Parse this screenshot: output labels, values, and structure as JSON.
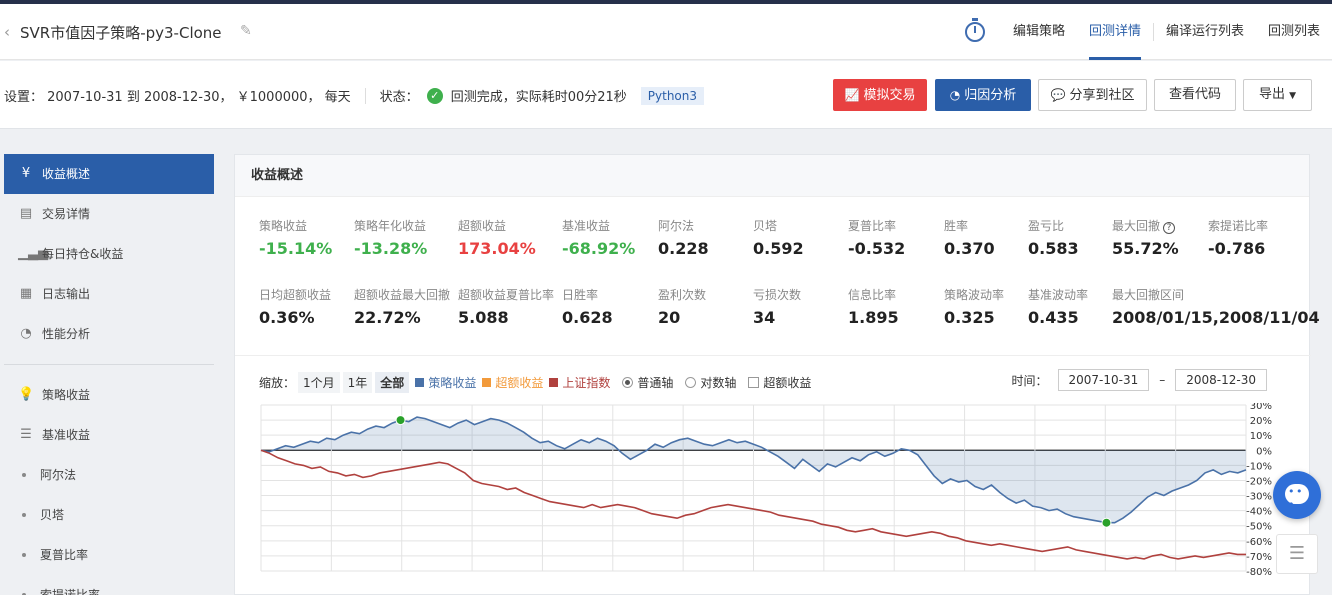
{
  "header": {
    "back_icon": "chevron-left",
    "title": "SVR市值因子策略-py3-Clone",
    "nav": [
      "编辑策略",
      "回测详情",
      "编译运行列表",
      "回测列表"
    ],
    "active_nav": "回测详情"
  },
  "info": {
    "settings": "设置： 2007-10-31 到 2008-12-30， ￥1000000， 每天",
    "status_label": "状态：",
    "status_text": "回测完成，实际耗时00分21秒",
    "language": "Python3"
  },
  "buttons": {
    "simulate": "模拟交易",
    "attribution": "归因分析",
    "share": "分享到社区",
    "view_code": "查看代码",
    "export": "导出"
  },
  "sidebar": {
    "items": [
      {
        "label": "收益概述",
        "icon": "yen-icon",
        "active": true
      },
      {
        "label": "交易详情",
        "icon": "doc-icon"
      },
      {
        "label": "每日持仓&收益",
        "icon": "chart-icon"
      },
      {
        "label": "日志输出",
        "icon": "log-icon"
      },
      {
        "label": "性能分析",
        "icon": "pie-icon"
      }
    ],
    "sub_items": [
      {
        "label": "策略收益",
        "icon": "bulb-icon"
      },
      {
        "label": "基准收益",
        "icon": "db-icon"
      },
      {
        "label": "阿尔法",
        "icon": "dot"
      },
      {
        "label": "贝塔",
        "icon": "dot"
      },
      {
        "label": "夏普比率",
        "icon": "dot"
      },
      {
        "label": "索提诺比率",
        "icon": "dot"
      }
    ]
  },
  "panel": {
    "title": "收益概述",
    "metrics_row1": [
      {
        "label": "策略收益",
        "value": "-15.14%",
        "color": "green"
      },
      {
        "label": "策略年化收益",
        "value": "-13.28%",
        "color": "green"
      },
      {
        "label": "超额收益",
        "value": "173.04%",
        "color": "red"
      },
      {
        "label": "基准收益",
        "value": "-68.92%",
        "color": "green"
      },
      {
        "label": "阿尔法",
        "value": "0.228",
        "color": ""
      },
      {
        "label": "贝塔",
        "value": "0.592",
        "color": ""
      },
      {
        "label": "夏普比率",
        "value": "-0.532",
        "color": ""
      },
      {
        "label": "胜率",
        "value": "0.370",
        "color": ""
      },
      {
        "label": "盈亏比",
        "value": "0.583",
        "color": ""
      },
      {
        "label": "最大回撤",
        "value": "55.72%",
        "color": ""
      },
      {
        "label": "索提诺比率",
        "value": "-0.786",
        "color": ""
      }
    ],
    "metrics_row2": [
      {
        "label": "日均超额收益",
        "value": "0.36%"
      },
      {
        "label": "超额收益最大回撤",
        "value": "22.72%"
      },
      {
        "label": "超额收益夏普比率",
        "value": "5.088"
      },
      {
        "label": "日胜率",
        "value": "0.628"
      },
      {
        "label": "盈利次数",
        "value": "20"
      },
      {
        "label": "亏损次数",
        "value": "34"
      },
      {
        "label": "信息比率",
        "value": "1.895"
      },
      {
        "label": "策略波动率",
        "value": "0.325"
      },
      {
        "label": "基准波动率",
        "value": "0.435"
      },
      {
        "label": "最大回撤区间",
        "value": "2008/01/15,2008/11/04"
      }
    ]
  },
  "chart_controls": {
    "zoom_label": "缩放：",
    "zoom_options": [
      "1个月",
      "1年",
      "全部"
    ],
    "active_zoom": "全部",
    "legend": [
      {
        "name": "策略收益",
        "color": "#4a72a8"
      },
      {
        "name": "超额收益",
        "color": "#f29a3b"
      },
      {
        "name": "上证指数",
        "color": "#b0413e"
      }
    ],
    "axis_options": [
      "普通轴",
      "对数轴"
    ],
    "active_axis": "普通轴",
    "excess_checkbox": "超额收益",
    "time_label": "时间：",
    "start_date": "2007-10-31",
    "end_date": "2008-12-30",
    "range_sep": "–"
  },
  "chart_data": {
    "type": "line",
    "y_ticks": [
      "30%",
      "20%",
      "10%",
      "0%",
      "-10%",
      "-20%",
      "-30%",
      "-40%",
      "-50%",
      "-60%",
      "-70%",
      "-80%"
    ],
    "ylim": [
      -80,
      30
    ],
    "series": [
      {
        "name": "策略收益",
        "color": "#4a72a8",
        "values": [
          0,
          -1,
          1,
          3,
          2,
          4,
          6,
          5,
          8,
          7,
          10,
          12,
          11,
          14,
          16,
          15,
          18,
          20,
          19,
          22,
          21,
          19,
          17,
          15,
          18,
          20,
          17,
          19,
          21,
          20,
          18,
          15,
          12,
          8,
          5,
          6,
          3,
          1,
          4,
          7,
          5,
          8,
          6,
          3,
          -2,
          -6,
          -3,
          0,
          4,
          2,
          5,
          7,
          8,
          6,
          4,
          3,
          5,
          7,
          5,
          6,
          4,
          2,
          -1,
          -4,
          -8,
          -12,
          -6,
          -10,
          -14,
          -9,
          -11,
          -8,
          -5,
          -7,
          -3,
          -1,
          -4,
          -2,
          1,
          0,
          -3,
          -10,
          -17,
          -22,
          -19,
          -21,
          -20,
          -24,
          -26,
          -23,
          -28,
          -32,
          -35,
          -33,
          -37,
          -38,
          -40,
          -39,
          -42,
          -44,
          -45,
          -46,
          -47,
          -48,
          -48,
          -45,
          -41,
          -36,
          -31,
          -28,
          -30,
          -27,
          -25,
          -23,
          -20,
          -15,
          -13,
          -16,
          -14,
          -15,
          -13
        ]
      },
      {
        "name": "上证指数",
        "color": "#b0413e",
        "values": [
          0,
          -2,
          -5,
          -7,
          -9,
          -10,
          -12,
          -11,
          -14,
          -15,
          -17,
          -16,
          -18,
          -17,
          -15,
          -14,
          -13,
          -12,
          -11,
          -10,
          -9,
          -8,
          -9,
          -12,
          -15,
          -20,
          -22,
          -23,
          -24,
          -26,
          -25,
          -28,
          -30,
          -32,
          -34,
          -35,
          -36,
          -37,
          -38,
          -36,
          -38,
          -37,
          -36,
          -37,
          -38,
          -40,
          -42,
          -43,
          -44,
          -45,
          -43,
          -42,
          -40,
          -38,
          -37,
          -36,
          -37,
          -38,
          -39,
          -40,
          -41,
          -43,
          -44,
          -45,
          -46,
          -47,
          -49,
          -50,
          -51,
          -53,
          -54,
          -53,
          -52,
          -54,
          -55,
          -56,
          -57,
          -56,
          -55,
          -54,
          -55,
          -57,
          -58,
          -60,
          -61,
          -62,
          -63,
          -62,
          -63,
          -64,
          -65,
          -66,
          -67,
          -66,
          -65,
          -64,
          -66,
          -67,
          -68,
          -69,
          -70,
          -71,
          -72,
          -71,
          -72,
          -70,
          -69,
          -71,
          -72,
          -71,
          -70,
          -71,
          -70,
          -69,
          -68,
          -69,
          -69
        ]
      }
    ],
    "markers": [
      {
        "series": "策略收益",
        "index": 17,
        "color": "#2aa12a"
      },
      {
        "series": "策略收益",
        "index": 103,
        "color": "#2aa12a"
      }
    ]
  }
}
